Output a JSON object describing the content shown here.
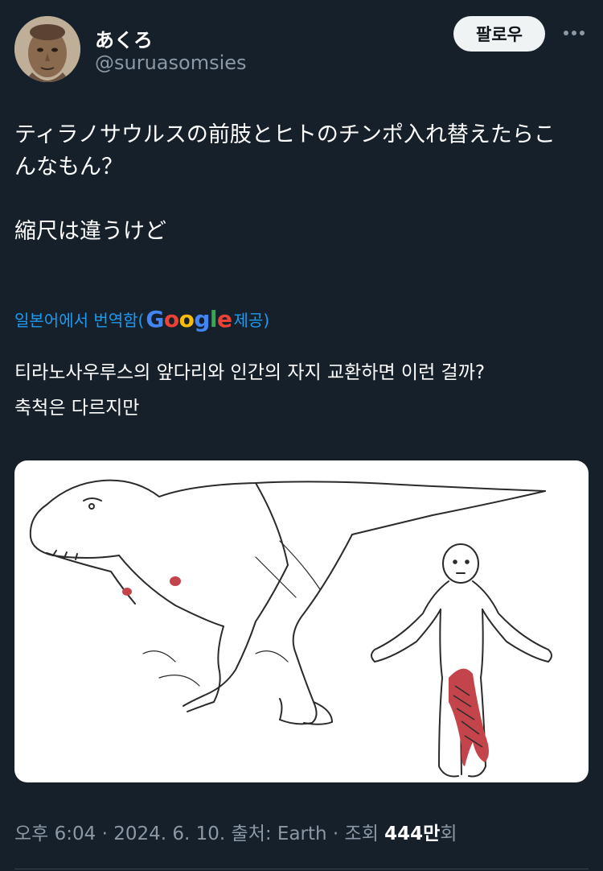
{
  "author": {
    "display_name": "あくろ",
    "handle": "@suruasomsies",
    "follow_label": "팔로우"
  },
  "tweet": {
    "lines": [
      "ティラノサウルスの前肢とヒトのチンポ入れ替えたらこ",
      "んなもん？",
      "縮尺は違うけど"
    ]
  },
  "translation": {
    "prefix": "일본어에서 번역함(",
    "provider": "Google",
    "suffix": " 제공)",
    "lines": [
      "티라노사우루스의 앞다리와 인간의 자지 교환하면 이런 걸까?",
      "축척은 다르지만"
    ]
  },
  "meta": {
    "time": "오후 6:04",
    "sep1": " · ",
    "date": "2024. 6. 10.",
    "source": " 출처: Earth",
    "sep2": " · ",
    "views_label": "조회 ",
    "views_count": "444만",
    "views_suffix": "회"
  },
  "colors": {
    "background": "#15202b",
    "text_primary": "#ffffff",
    "text_secondary": "#8b98a5",
    "link": "#1d9bf0",
    "button_bg": "#eff3f4",
    "highlight_red": "#c4444b"
  },
  "icons": {
    "more": "more-horizontal-icon"
  }
}
